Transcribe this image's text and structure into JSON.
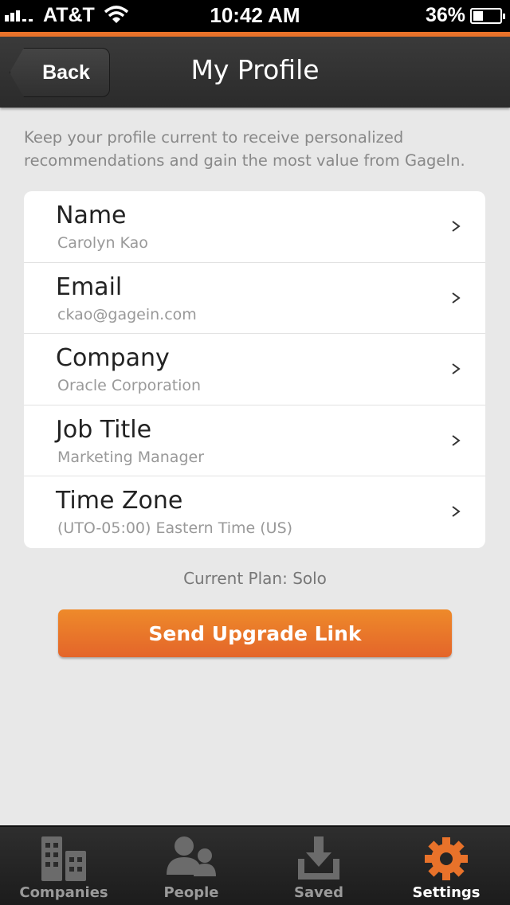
{
  "status_bar": {
    "carrier": "AT&T",
    "time": "10:42 AM",
    "battery_percent": "36%",
    "battery_level": 0.36,
    "signal_bars": 3
  },
  "nav": {
    "back_label": "Back",
    "title": "My Profile"
  },
  "intro_text": "Keep your profile current to receive personalized recommendations and gain the most value from GageIn.",
  "profile": {
    "fields": [
      {
        "label": "Name",
        "value": "Carolyn Kao"
      },
      {
        "label": "Email",
        "value": "ckao@gagein.com"
      },
      {
        "label": "Company",
        "value": "Oracle Corporation"
      },
      {
        "label": "Job Title",
        "value": "Marketing Manager"
      },
      {
        "label": "Time Zone",
        "value": "(UTO-05:00) Eastern Time (US)"
      }
    ]
  },
  "plan_text": "Current Plan: Solo",
  "upgrade_button_label": "Send Upgrade Link",
  "tabs": [
    {
      "label": "Companies",
      "icon": "buildings-icon",
      "active": false
    },
    {
      "label": "People",
      "icon": "people-icon",
      "active": false
    },
    {
      "label": "Saved",
      "icon": "download-tray-icon",
      "active": false
    },
    {
      "label": "Settings",
      "icon": "gear-icon",
      "active": true
    }
  ],
  "colors": {
    "accent": "#e8722a",
    "nav_background": "#2b2b2b",
    "page_background": "#e8e8e8",
    "active_tab_icon": "#e8722a",
    "inactive_tab_icon": "#6b6b6b"
  }
}
